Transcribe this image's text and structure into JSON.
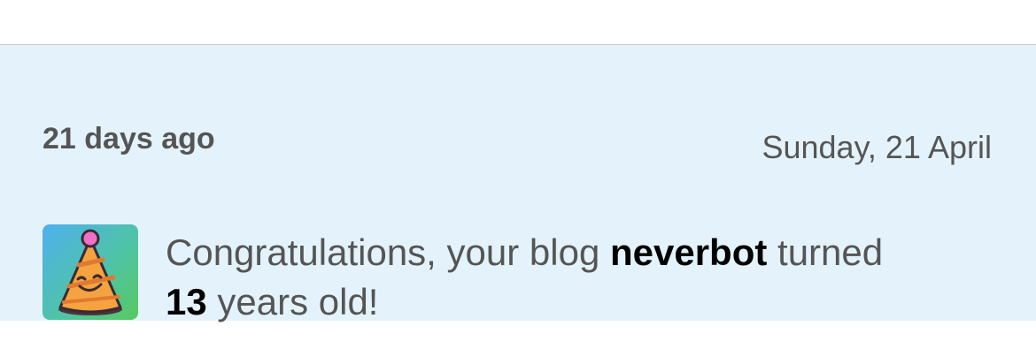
{
  "notification": {
    "relative_time": "21 days ago",
    "date": "Sunday, 21 April",
    "message": {
      "prefix": "Congratulations, your blog ",
      "blog_name": "neverbot",
      "middle": " turned ",
      "years": "13",
      "suffix": " years old!"
    },
    "icon": "party-hat-icon"
  },
  "colors": {
    "background": "#e4f3fb",
    "muted_text": "#555555",
    "emphasis_text": "#000000"
  }
}
